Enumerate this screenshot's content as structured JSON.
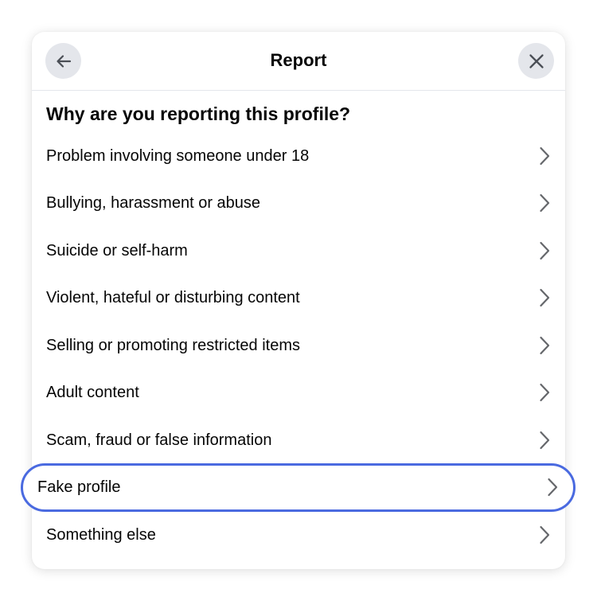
{
  "header": {
    "title": "Report",
    "back_icon": "arrow-left-icon",
    "close_icon": "close-icon"
  },
  "question": "Why are you reporting this profile?",
  "options": [
    {
      "label": "Problem involving someone under 18"
    },
    {
      "label": "Bullying, harassment or abuse"
    },
    {
      "label": "Suicide or self-harm"
    },
    {
      "label": "Violent, hateful or disturbing content"
    },
    {
      "label": "Selling or promoting restricted items"
    },
    {
      "label": "Adult content"
    },
    {
      "label": "Scam, fraud or false information"
    },
    {
      "label": "Fake profile",
      "highlighted": true
    },
    {
      "label": "Something else"
    }
  ],
  "colors": {
    "highlight_outline": "#4a6ae0",
    "button_background": "#e4e6eb",
    "text": "#050505",
    "icon": "#65676b"
  }
}
